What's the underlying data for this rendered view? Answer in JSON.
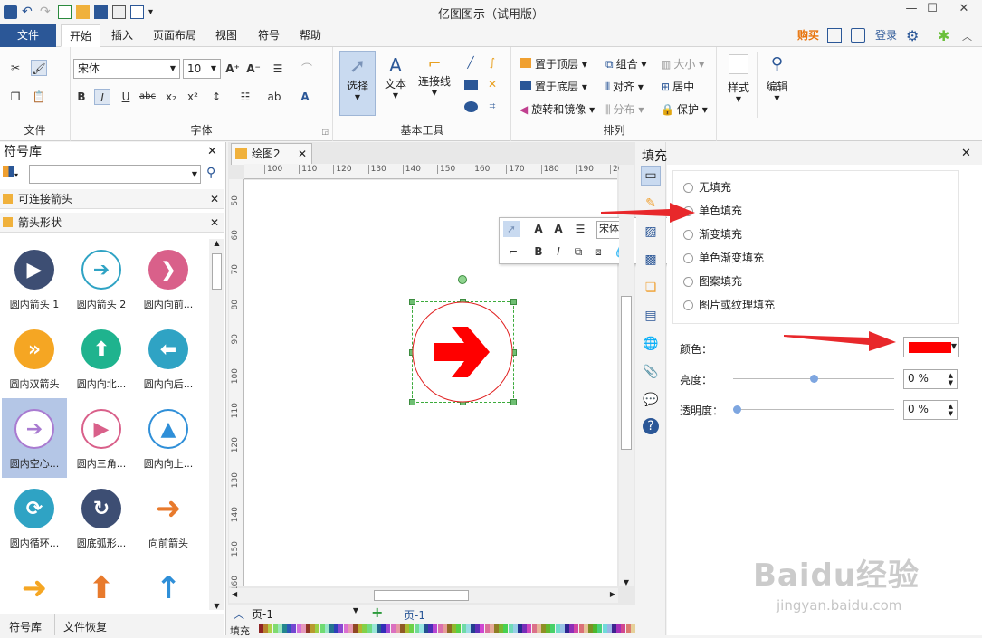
{
  "window": {
    "title": "亿图图示（试用版）"
  },
  "tabs": [
    "文件",
    "开始",
    "插入",
    "页面布局",
    "视图",
    "符号",
    "帮助"
  ],
  "top_right": {
    "buy": "购买",
    "login": "登录"
  },
  "ribbon": {
    "groups": {
      "file": "文件",
      "font": "字体",
      "basic_tools": "基本工具",
      "arrange": "排列"
    },
    "font_name": "宋体",
    "font_size": "10",
    "big_buttons": {
      "select": "选择",
      "text": "文本",
      "connector": "连接线",
      "style": "样式",
      "edit": "编辑"
    },
    "arrange_items": [
      "置于顶层",
      "置于底层",
      "旋转和镜像",
      "组合",
      "对齐",
      "分布",
      "大小",
      "居中",
      "保护"
    ]
  },
  "left_panel": {
    "title": "符号库",
    "search_placeholder": "",
    "sections": [
      "可连接箭头",
      "箭头形状"
    ],
    "shapes": [
      {
        "label": "圆内箭头 1",
        "color": "#3d4e73",
        "glyph": "▶",
        "style": "solid"
      },
      {
        "label": "圆内箭头 2",
        "color": "#2fa3c4",
        "glyph": "➔",
        "style": "outline"
      },
      {
        "label": "圆内向前...",
        "color": "#d9608a",
        "glyph": "❯",
        "style": "solid"
      },
      {
        "label": "圆内双箭头",
        "color": "#f5a623",
        "glyph": "»",
        "style": "solid"
      },
      {
        "label": "圆内向北...",
        "color": "#1fb38e",
        "glyph": "⬆",
        "style": "solid"
      },
      {
        "label": "圆内向后...",
        "color": "#2fa3c4",
        "glyph": "⬅",
        "style": "solid"
      },
      {
        "label": "圆内空心...",
        "color": "#a97bd1",
        "glyph": "➔",
        "style": "outline",
        "selected": true
      },
      {
        "label": "圆内三角...",
        "color": "#d9608a",
        "glyph": "▶",
        "style": "outline"
      },
      {
        "label": "圆内向上...",
        "color": "#2f8fd8",
        "glyph": "▲",
        "style": "outline"
      },
      {
        "label": "圆内循环...",
        "color": "#2fa3c4",
        "glyph": "⟳",
        "style": "solid"
      },
      {
        "label": "圆底弧形...",
        "color": "#3d4e73",
        "glyph": "↻",
        "style": "solid"
      },
      {
        "label": "向前箭头",
        "color": "#e87a2c",
        "glyph": "➜",
        "style": "plain"
      },
      {
        "label": "",
        "color": "#f5a623",
        "glyph": "➜",
        "style": "plain"
      },
      {
        "label": "",
        "color": "#e87a2c",
        "glyph": "⬆",
        "style": "plain"
      },
      {
        "label": "",
        "color": "#2f8fd8",
        "glyph": "↑",
        "style": "plain"
      }
    ],
    "bottom_tabs": [
      "符号库",
      "文件恢复"
    ]
  },
  "canvas": {
    "doc_tab": "绘图2",
    "hruler": [
      "100",
      "110",
      "120",
      "130",
      "140",
      "150",
      "160",
      "170",
      "180",
      "190",
      "20"
    ],
    "vruler": [
      "50",
      "60",
      "70",
      "80",
      "90",
      "100",
      "110",
      "120",
      "130",
      "140",
      "150",
      "160"
    ],
    "page_select": "页-1",
    "page_tab": "页-1",
    "fill_label": "填充",
    "float_font": "宋体",
    "shape_colors": {
      "circle": "#e02020",
      "arrow": "#ff0000"
    }
  },
  "fill_panel": {
    "title": "填充",
    "options": [
      "无填充",
      "单色填充",
      "渐变填充",
      "单色渐变填充",
      "图案填充",
      "图片或纹理填充"
    ],
    "color_label": "颜色：",
    "color_value": "#ff0000",
    "brightness_label": "亮度：",
    "brightness_value": "0 %",
    "brightness_level": 0.5,
    "transparency_label": "透明度：",
    "transparency_value": "0 %",
    "transparency_level": 0.0
  },
  "watermark": {
    "brand": "Baidu经验",
    "url": "jingyan.baidu.com"
  }
}
